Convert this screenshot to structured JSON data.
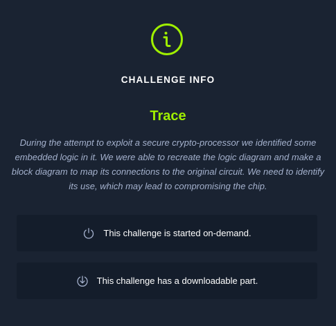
{
  "modal": {
    "icon": "info-circle-icon",
    "heading": "CHALLENGE INFO",
    "challenge_name": "Trace",
    "description": "During the attempt to exploit a secure crypto-processor we identified some embedded logic in it. We were able to recreate the logic diagram and make a block diagram to map its connections to the original circuit. We need to identify its use, which may lead to compromising the chip.",
    "features": [
      {
        "icon": "power-icon",
        "text": "This challenge is started on-demand."
      },
      {
        "icon": "download-icon",
        "text": "This challenge has a downloadable part."
      }
    ]
  },
  "colors": {
    "background": "#1a2332",
    "card": "#141d2b",
    "accent": "#9fef00",
    "muted_text": "#a4b1cd",
    "icon_gray": "#a4b1cd"
  }
}
